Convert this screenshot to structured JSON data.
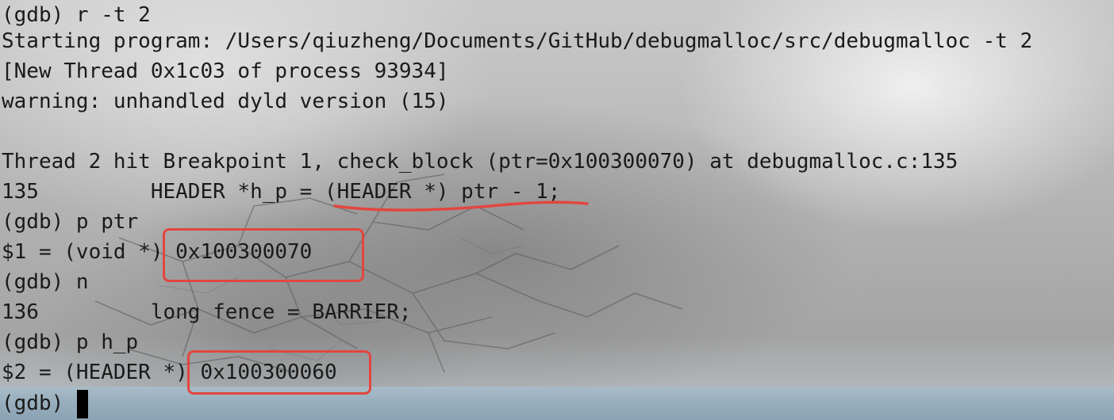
{
  "terminal": {
    "lines": [
      "(gdb) r -t 2",
      "Starting program: /Users/qiuzheng/Documents/GitHub/debugmalloc/src/debugmalloc -t 2",
      "[New Thread 0x1c03 of process 93934]",
      "warning: unhandled dyld version (15)",
      "",
      "Thread 2 hit Breakpoint 1, check_block (ptr=0x100300070) at debugmalloc.c:135",
      "135         HEADER *h_p = (HEADER *) ptr - 1;",
      "(gdb) p ptr",
      "$1 = (void *) 0x100300070",
      "(gdb) n",
      "136         long fence = BARRIER;",
      "(gdb) p h_p",
      "$2 = (HEADER *) 0x100300060",
      "(gdb) "
    ]
  },
  "annotations": {
    "color": "#e2463f",
    "items": [
      "underline",
      "box",
      "box"
    ]
  }
}
